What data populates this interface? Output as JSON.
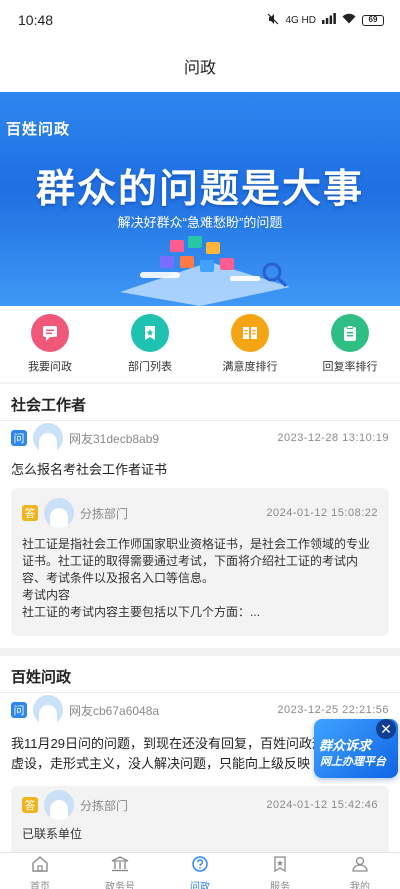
{
  "status_bar": {
    "time": "10:48",
    "network": "4G HD",
    "battery": "69"
  },
  "header": {
    "title": "问政"
  },
  "banner": {
    "tag": "百姓问政",
    "title": "群众的问题是大事",
    "subtitle": "解决好群众“急难愁盼”的问题"
  },
  "quick_menu": {
    "items": [
      {
        "label": "我要问政",
        "icon": "message-icon",
        "color": "#f0587a"
      },
      {
        "label": "部门列表",
        "icon": "bookmark-icon",
        "color": "#1fc1b0"
      },
      {
        "label": "满意度排行",
        "icon": "ranking-icon",
        "color": "#f5a414"
      },
      {
        "label": "回复率排行",
        "icon": "clipboard-icon",
        "color": "#2fbf85"
      }
    ]
  },
  "sections": [
    {
      "title": "社会工作者",
      "question_tag": "问",
      "user": "网友31decb8ab9",
      "time": "2023-12-28  13:10:19",
      "question": "怎么报名考社会工作者证书",
      "reply": {
        "tag": "答",
        "department": "分拣部门",
        "time": "2024-01-12  15:08:22",
        "line1": "社工证是指社会工作师国家职业资格证书，是社会工作领域的专业证书。社工证的取得需要通过考试，下面将介绍社工证的考试内容、考试条件以及报名入口等信息。",
        "line2": "考试内容",
        "line3": "社工证的考试内容主要包括以下几个方面：..."
      }
    },
    {
      "title": "百姓问政",
      "question_tag": "问",
      "user": "网友cb67a6048a",
      "time": "2023-12-25  22:21:56",
      "question": "我11月29日问的问题，到现在还没有回复，百姓问政形同虚设，走形式主义，没人解决问题，只能向上级反映",
      "reply": {
        "tag": "答",
        "department": "分拣部门",
        "time": "2024-01-12  15:42:46",
        "line1": "已联系单位"
      }
    }
  ],
  "float_ad": {
    "line1": "群众诉求",
    "line2": "网上办理平台",
    "close": "✕"
  },
  "tab_bar": {
    "tabs": [
      {
        "label": "首页",
        "icon": "home-icon"
      },
      {
        "label": "政务号",
        "icon": "government-icon"
      },
      {
        "label": "问政",
        "icon": "question-icon",
        "active": true
      },
      {
        "label": "服务",
        "icon": "star-bookmark-icon"
      },
      {
        "label": "我的",
        "icon": "user-icon"
      }
    ]
  },
  "colors": {
    "primary": "#2f86f0",
    "answer_tag": "#f0b319",
    "inactive": "#8a8a8a"
  }
}
